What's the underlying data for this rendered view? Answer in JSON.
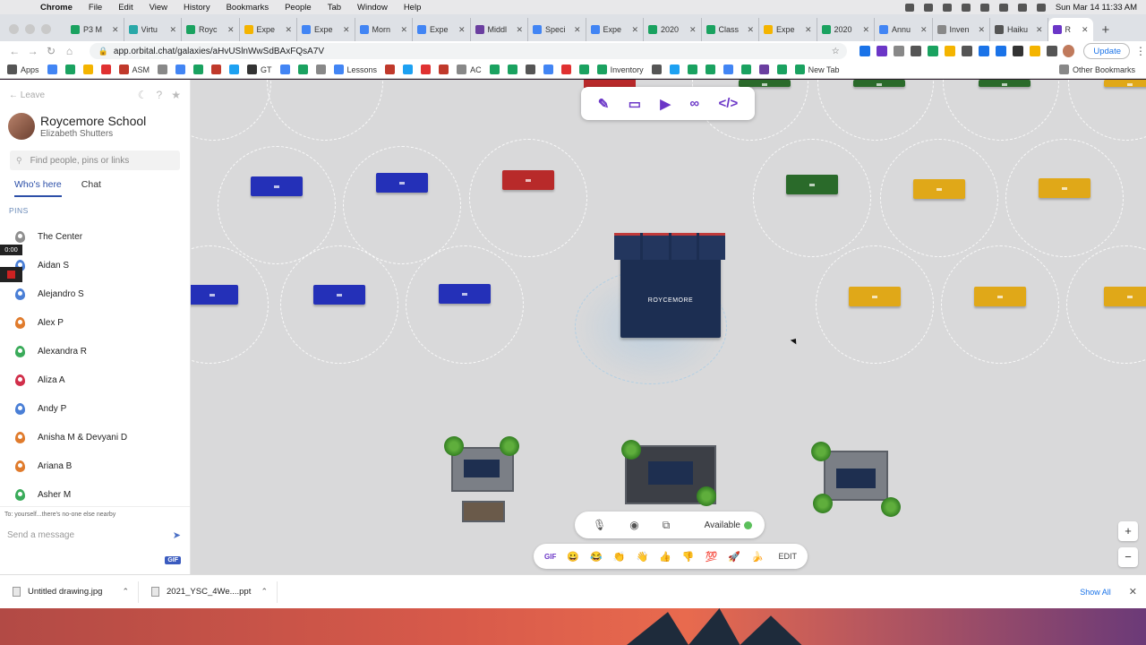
{
  "macos": {
    "apple": "",
    "menus": [
      "Chrome",
      "File",
      "Edit",
      "View",
      "History",
      "Bookmarks",
      "People",
      "Tab",
      "Window",
      "Help"
    ],
    "clock": "Sun Mar 14  11:33 AM"
  },
  "tabs": [
    {
      "label": "P3 M",
      "color": "#1aa260"
    },
    {
      "label": "Virtu",
      "color": "#2aa8a8"
    },
    {
      "label": "Royc",
      "color": "#1aa260"
    },
    {
      "label": "Expe",
      "color": "#f4b400"
    },
    {
      "label": "Expe",
      "color": "#4285f4"
    },
    {
      "label": "Morn",
      "color": "#4285f4"
    },
    {
      "label": "Expe",
      "color": "#4285f4"
    },
    {
      "label": "Middl",
      "color": "#6b3fa0"
    },
    {
      "label": "Speci",
      "color": "#4285f4"
    },
    {
      "label": "Expe",
      "color": "#4285f4"
    },
    {
      "label": "2020",
      "color": "#1aa260"
    },
    {
      "label": "Class",
      "color": "#1aa260"
    },
    {
      "label": "Expe",
      "color": "#f4b400"
    },
    {
      "label": "2020",
      "color": "#1aa260"
    },
    {
      "label": "Annu",
      "color": "#4285f4"
    },
    {
      "label": "Inven",
      "color": "#888888"
    },
    {
      "label": "Haiku",
      "color": "#555555"
    },
    {
      "label": "R",
      "color": "#6b36c7",
      "active": true
    }
  ],
  "address": {
    "url": "app.orbital.chat/galaxies/aHvUSlnWwSdBAxFQsA7V",
    "update_label": "Update"
  },
  "bookmarks": [
    {
      "label": "Apps",
      "color": "#555555"
    },
    {
      "label": "",
      "color": "#4285f4"
    },
    {
      "label": "",
      "color": "#1aa260"
    },
    {
      "label": "",
      "color": "#f4b400"
    },
    {
      "label": "",
      "color": "#e03131"
    },
    {
      "label": "ASM",
      "color": "#c0392b"
    },
    {
      "label": "",
      "color": "#888888"
    },
    {
      "label": "",
      "color": "#4285f4"
    },
    {
      "label": "",
      "color": "#1aa260"
    },
    {
      "label": "",
      "color": "#c0392b"
    },
    {
      "label": "",
      "color": "#1da1f2"
    },
    {
      "label": "GT",
      "color": "#333333"
    },
    {
      "label": "",
      "color": "#4285f4"
    },
    {
      "label": "",
      "color": "#1aa260"
    },
    {
      "label": "",
      "color": "#888888"
    },
    {
      "label": "Lessons",
      "color": "#4285f4"
    },
    {
      "label": "",
      "color": "#c0392b"
    },
    {
      "label": "",
      "color": "#1da1f2"
    },
    {
      "label": "",
      "color": "#e03131"
    },
    {
      "label": "",
      "color": "#c0392b"
    },
    {
      "label": "AC",
      "color": "#888888"
    },
    {
      "label": "",
      "color": "#1aa260"
    },
    {
      "label": "",
      "color": "#1aa260"
    },
    {
      "label": "",
      "color": "#555555"
    },
    {
      "label": "",
      "color": "#4285f4"
    },
    {
      "label": "",
      "color": "#e03131"
    },
    {
      "label": "",
      "color": "#1aa260"
    },
    {
      "label": "Inventory",
      "color": "#1aa260"
    },
    {
      "label": "",
      "color": "#555555"
    },
    {
      "label": "",
      "color": "#1da1f2"
    },
    {
      "label": "",
      "color": "#1aa260"
    },
    {
      "label": "",
      "color": "#1aa260"
    },
    {
      "label": "",
      "color": "#4285f4"
    },
    {
      "label": "",
      "color": "#1aa260"
    },
    {
      "label": "",
      "color": "#6b3fa0"
    },
    {
      "label": "",
      "color": "#1aa260"
    },
    {
      "label": "New Tab",
      "color": "#1aa260"
    }
  ],
  "bookmarks_other": "Other Bookmarks",
  "sidebar": {
    "leave": "Leave",
    "org_name": "Roycemore School",
    "user_name": "Elizabeth Shutters",
    "search_placeholder": "Find people, pins or links",
    "tabs": [
      "Who's here",
      "Chat"
    ],
    "pins_label": "PINS",
    "timer": "0:00",
    "pins": [
      {
        "name": "The Center",
        "color": "#8f8f8f"
      },
      {
        "name": "Aidan S",
        "color": "#4a7fd6"
      },
      {
        "name": "Alejandro S",
        "color": "#4a7fd6"
      },
      {
        "name": "Alex P",
        "color": "#e07b2c"
      },
      {
        "name": "Alexandra R",
        "color": "#3aab5a"
      },
      {
        "name": "Aliza A",
        "color": "#d12f4a"
      },
      {
        "name": "Andy P",
        "color": "#4a7fd6"
      },
      {
        "name": "Anisha M & Devyani D",
        "color": "#e07b2c"
      },
      {
        "name": "Ariana B",
        "color": "#e07b2c"
      },
      {
        "name": "Asher M",
        "color": "#3aab5a"
      }
    ],
    "chat_note": "To: yourself...there's no-one else nearby",
    "message_placeholder": "Send a message",
    "gif_label": "GIF"
  },
  "canvas": {
    "stage_logo": "ROYCEMORE",
    "status_label": "Available",
    "emoji_gif": "GIF",
    "emojis": [
      "😀",
      "😂",
      "👏",
      "👋",
      "👍",
      "👎",
      "💯",
      "🚀",
      "🍌"
    ],
    "emoji_edit": "EDIT"
  },
  "downloads": [
    {
      "name": "Untitled drawing.jpg"
    },
    {
      "name": "2021_YSC_4We....ppt"
    }
  ],
  "downloads_show_all": "Show All"
}
